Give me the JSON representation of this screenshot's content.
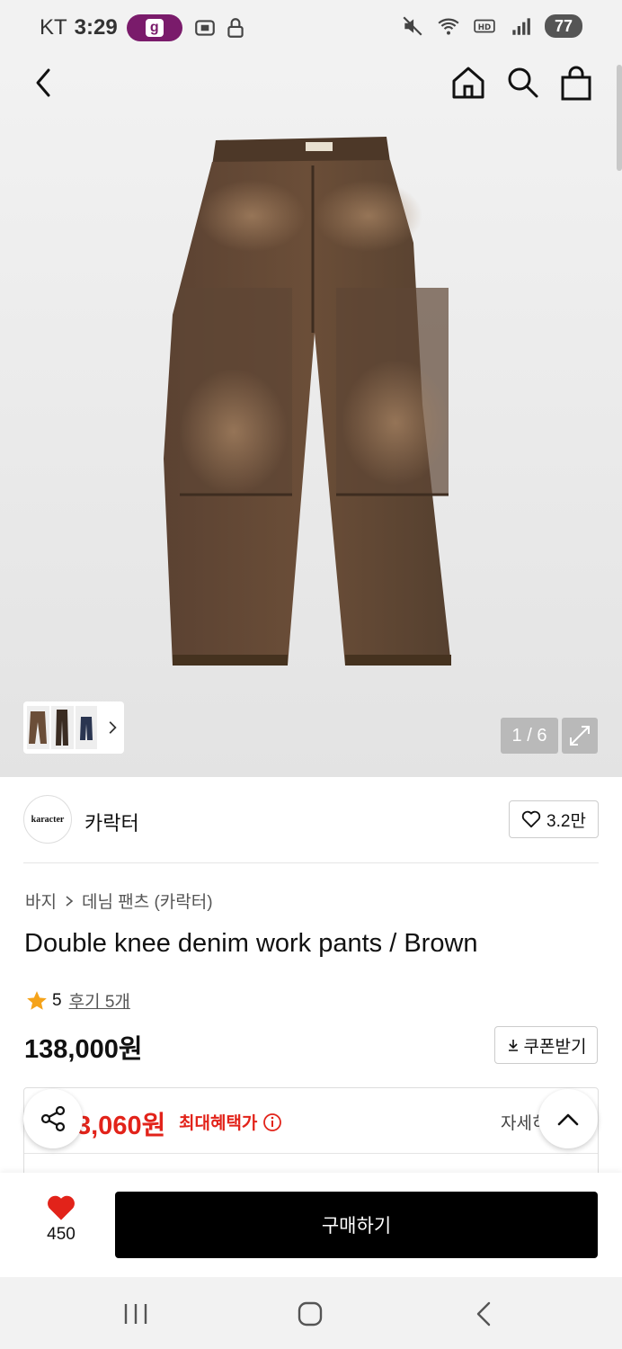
{
  "status_bar": {
    "carrier": "KT",
    "time": "3:29",
    "app_badge": "g",
    "battery": "77"
  },
  "gallery": {
    "counter": "1 / 6",
    "thumbnail_count": 3
  },
  "brand": {
    "logo_text": "karacter",
    "name": "카락터",
    "like_count": "3.2만"
  },
  "breadcrumb": {
    "category": "바지",
    "subcategory": "데님 팬츠 (카락터)"
  },
  "product": {
    "title": "Double knee denim work pants / Brown",
    "rating": "5",
    "review_text": "후기 5개",
    "price": "138,000원",
    "coupon_label": "쿠폰받기"
  },
  "benefit": {
    "price": "3,060원",
    "label": "최대혜택가",
    "detail_text": "자세히"
  },
  "bottom_bar": {
    "wish_count": "450",
    "buy_label": "구매하기"
  },
  "colors": {
    "accent_red": "#e2231a",
    "button_black": "#000000",
    "pants_brown": "#5a4030"
  }
}
